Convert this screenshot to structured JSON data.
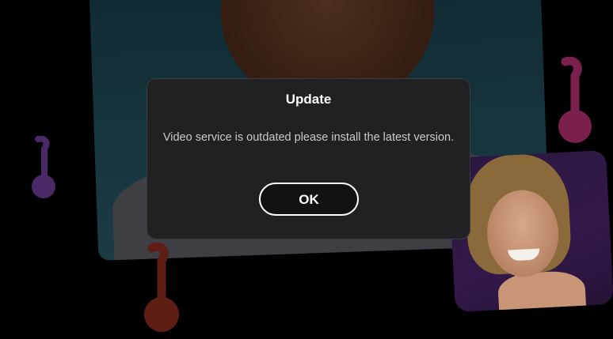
{
  "dialog": {
    "title": "Update",
    "message": "Video service is outdated please install the latest version.",
    "ok_label": "OK"
  },
  "colors": {
    "backdrop": "#000000",
    "dialog_bg": "#1f2123",
    "dialog_border": "#3a3c3f",
    "title_text": "#ffffff",
    "message_text": "#c9cbcd",
    "note_pink": "#7a1f4e",
    "note_purple": "#4a2a66",
    "note_red": "#5e1e14"
  },
  "background": {
    "cards": [
      "portrait-photo-man",
      "portrait-photo-woman"
    ],
    "decorations": [
      "music-note-icon",
      "music-note-icon",
      "music-note-icon"
    ]
  }
}
